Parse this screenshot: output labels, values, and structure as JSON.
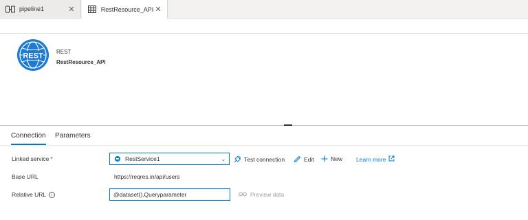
{
  "tabs": [
    {
      "label": "pipeline1",
      "icon": "pipeline-icon",
      "close": "✕"
    },
    {
      "label": "RestResource_API",
      "icon": "dataset-table-icon",
      "close": "✕"
    }
  ],
  "header": {
    "logo_text": "REST",
    "type": "REST",
    "name": "RestResource_API"
  },
  "subtabs": [
    {
      "label": "Connection",
      "active": true
    },
    {
      "label": "Parameters",
      "active": false
    }
  ],
  "form": {
    "linked_service": {
      "label": "Linked service",
      "required_mark": "*",
      "value": "RestService1",
      "actions": {
        "test": "Test connection",
        "edit": "Edit",
        "new": "New",
        "learn": "Learn more"
      }
    },
    "base_url": {
      "label": "Base URL",
      "value": "https://reqres.in/api/users"
    },
    "relative_url": {
      "label": "Relative URL",
      "info": "i",
      "value": "@dataset().Queryparameter",
      "preview": "Preview data"
    }
  },
  "colors": {
    "accent": "#0078d4",
    "logo": "#1e7bd3",
    "required": "#a4262c"
  }
}
